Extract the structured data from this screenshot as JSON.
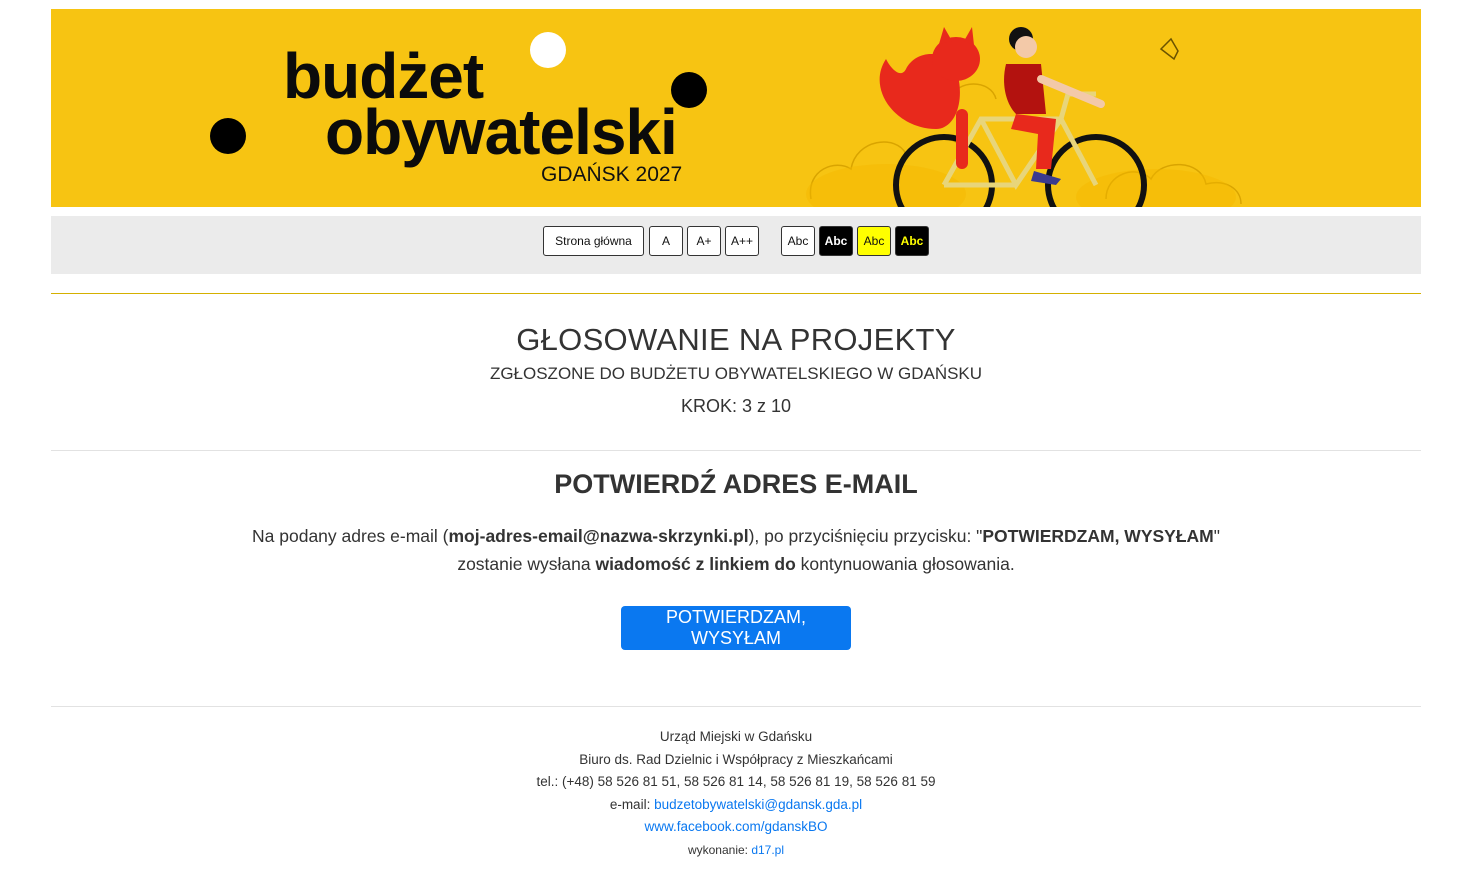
{
  "banner": {
    "logo_line1": "budżet",
    "logo_line2": "obywatelski",
    "logo_city": "GDAŃSK 2027",
    "illustration_icon": "cat-and-girl-on-tandem-bike-icon",
    "bg_color": "#f7c412"
  },
  "toolbar": {
    "home_label": "Strona główna",
    "font_a": "A",
    "font_a_plus": "A+",
    "font_a_plus_plus": "A++",
    "contrast_labels": [
      "Abc",
      "Abc",
      "Abc",
      "Abc"
    ]
  },
  "header": {
    "title": "GŁOSOWANIE NA PROJEKTY",
    "subtitle": "ZGŁOSZONE DO BUDŻETU OBYWATELSKIEGO W GDAŃSKU",
    "step": "KROK: 3 z 10"
  },
  "confirm": {
    "title": "POTWIERDŹ ADRES E-MAIL",
    "msg_part1": "Na podany adres e-mail (",
    "msg_email": "moj-adres-email@nazwa-skrzynki.pl",
    "msg_part2": "), po przyciśnięciu przycisku: \"",
    "msg_button_name": "POTWIERDZAM, WYSYŁAM",
    "msg_part3": "\"",
    "msg_part4": "zostanie wysłana ",
    "msg_bold2": "wiadomość z linkiem do",
    "msg_part5": " kontynuowania głosowania.",
    "button_label": "POTWIERDZAM, WYSYŁAM",
    "button_color": "#0a78f0"
  },
  "footer": {
    "org": "Urząd Miejski w Gdańsku",
    "dept": "Biuro ds. Rad Dzielnic i Współpracy z Mieszkańcami",
    "tel": "tel.: (+48) 58 526 81 51, 58 526 81 14, 58 526 81 19, 58 526 81 59",
    "email_label": "e-mail: ",
    "email": "budzetobywatelski@gdansk.gda.pl",
    "facebook": "www.facebook.com/gdanskBO",
    "made_by_label": "wykonanie: ",
    "made_by": "d17.pl"
  }
}
